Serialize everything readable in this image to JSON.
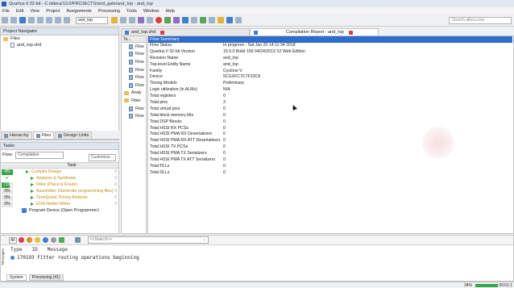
{
  "window": {
    "title": "Quartus II 32-bit - C:/altera/13.0/PROJECTS/and_gate/and_top - and_top"
  },
  "menu": [
    "File",
    "Edit",
    "View",
    "Project",
    "Assignments",
    "Processing",
    "Tools",
    "Window",
    "Help"
  ],
  "toolbar": {
    "entity_select": "and_top",
    "search_placeholder": "Search altera.com"
  },
  "project_navigator": {
    "title": "Project Navigator",
    "folder": "Files",
    "file": "and_top.vhd",
    "tabs": [
      "Hierarchy",
      "Files",
      "Design Units"
    ]
  },
  "tasks": {
    "title": "Tasks",
    "flow_label": "Flow:",
    "flow_value": "Compilation",
    "customize_label": "Customize...",
    "column": "Task",
    "items": [
      {
        "pct": "4%",
        "label": "Compile Design"
      },
      {
        "pct": "",
        "label": "Analysis & Synthesis"
      },
      {
        "pct": "71%",
        "label": "Fitter (Place & Route)"
      },
      {
        "pct": "0%",
        "label": "Assembler (Generate programming files)"
      },
      {
        "pct": "0%",
        "label": "TimeQuest Timing Analysis"
      },
      {
        "pct": "0%",
        "label": "EDA Netlist Writer"
      },
      {
        "pct": "",
        "label": "Program Device (Open Programmer)"
      }
    ],
    "zero": "0"
  },
  "doc_tabs": [
    {
      "label": "and_top.vhd"
    },
    {
      "label": "Compilation Report - and_top"
    }
  ],
  "report_nav": {
    "header": "Ta...",
    "items": [
      "Flow",
      "Flow",
      "Flow",
      "Flow",
      "Flow",
      "Flow",
      "Analy",
      "Fitter",
      "Flow",
      "Flow"
    ]
  },
  "flow_summary": {
    "title": "Flow Summary",
    "rows": [
      {
        "k": "Flow Status",
        "v": "In progress - Sat Jan 20 14:11:34 2018"
      },
      {
        "k": "Quartus II 32-bit Version",
        "v": "15.0.0 Build 156 04/24/2013 SJ Web Edition"
      },
      {
        "k": "Revision Name",
        "v": "and_top"
      },
      {
        "k": "Top-level Entity Name",
        "v": "and_top"
      },
      {
        "k": "Family",
        "v": "Cyclone V"
      },
      {
        "k": "Device",
        "v": "5CGXFC7C7F23C8"
      },
      {
        "k": "Timing Models",
        "v": "Preliminary"
      },
      {
        "k": "Logic utilization (in ALMs)",
        "v": "N/A"
      },
      {
        "k": "Total registers",
        "v": "0"
      },
      {
        "k": "Total pins",
        "v": "3"
      },
      {
        "k": "Total virtual pins",
        "v": "0"
      },
      {
        "k": "Total block memory bits",
        "v": "0"
      },
      {
        "k": "Total DSP Blocks",
        "v": "0"
      },
      {
        "k": "Total HSSI RX PCSs",
        "v": "0"
      },
      {
        "k": "Total HSSI PMA RX Deserializers",
        "v": "0"
      },
      {
        "k": "Total HSSI PMA RX ATT Deserializers",
        "v": "0"
      },
      {
        "k": "Total HSSI TX PCSs",
        "v": "0"
      },
      {
        "k": "Total HSSI PMA TX Serializers",
        "v": "0"
      },
      {
        "k": "Total HSSI PMA TX ATT Serializers",
        "v": "0"
      },
      {
        "k": "Total PLLs",
        "v": "0"
      },
      {
        "k": "Total DLLs",
        "v": "0"
      }
    ]
  },
  "messages": {
    "all_label": "All",
    "search_placeholder": "<<Search>>",
    "columns": [
      "Type",
      "ID",
      "Message"
    ],
    "line": "170193 Fitter routing operations beginning",
    "side_label": "Messages",
    "tabs": [
      "System",
      "Processing (41)"
    ]
  },
  "status": {
    "zoom": "34%",
    "time": "00:01:1"
  }
}
